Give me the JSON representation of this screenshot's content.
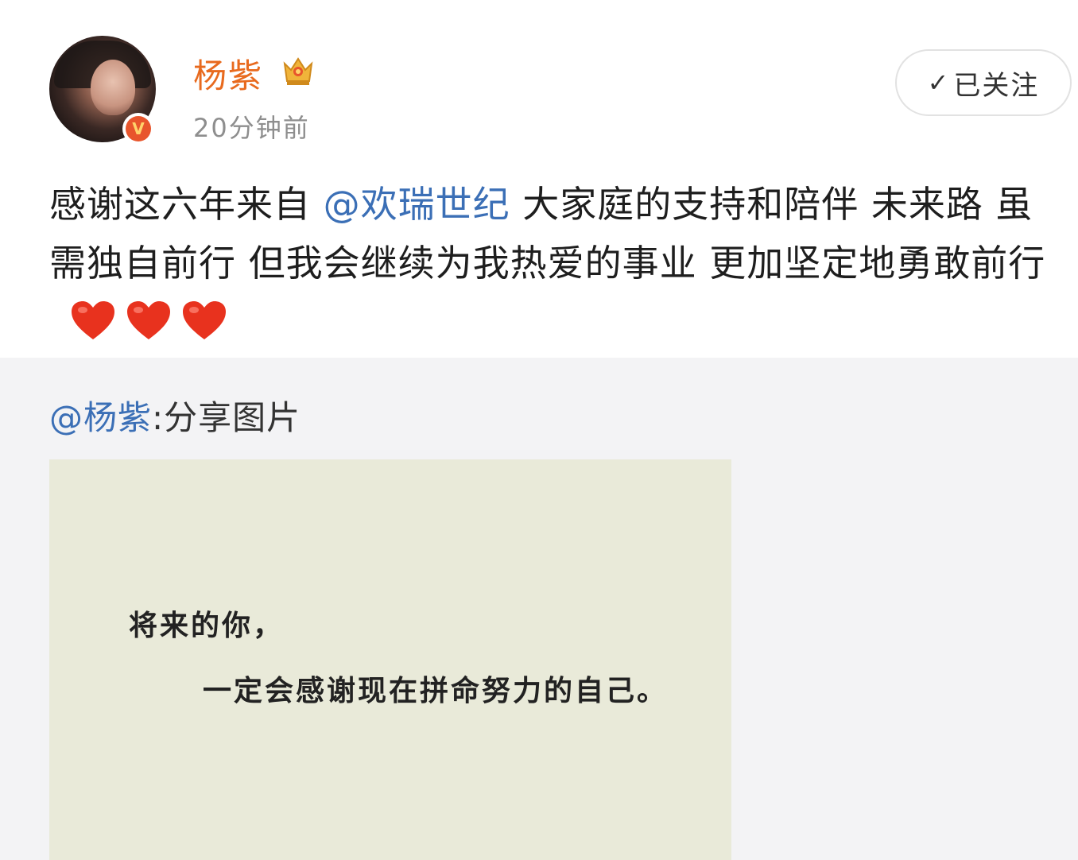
{
  "post": {
    "author": {
      "name": "杨紫",
      "time": "20分钟前",
      "badge": "V"
    },
    "follow_label": "已关注",
    "follow_check": "✓",
    "text_before_mention": "感谢这六年来自 ",
    "mention": "@欢瑞世纪",
    "text_after_mention": " 大家庭的支持和陪伴 未来路 虽需独自前行 但我会继续为我热爱的事业 更加坚定地勇敢前行",
    "heart_count": 3,
    "colors": {
      "name": "#e86a1e",
      "link": "#3b6fb6",
      "heart": "#e8321e"
    }
  },
  "repost": {
    "author_mention": "@杨紫",
    "share_text": ":分享图片",
    "image": {
      "line1": "将来的你，",
      "line2": "一定会感谢现在拼命努力的自己。"
    }
  }
}
